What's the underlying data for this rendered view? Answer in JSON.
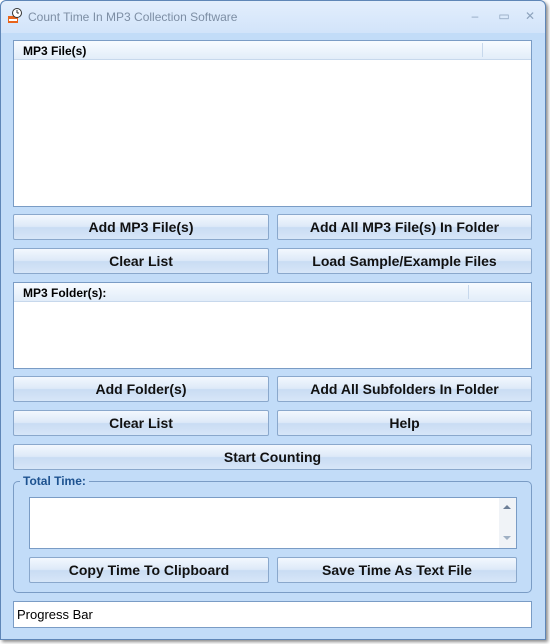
{
  "window": {
    "title": "Count Time In MP3 Collection Software",
    "controls": {
      "minimize": "–",
      "maximize": "▭",
      "close": "✕"
    }
  },
  "files_list": {
    "header": "MP3 File(s)",
    "items": []
  },
  "files_buttons": {
    "add_files": "Add MP3 File(s)",
    "add_all_in_folder": "Add All MP3 File(s) In Folder",
    "clear_list": "Clear List",
    "load_samples": "Load Sample/Example Files"
  },
  "folders_list": {
    "header": "MP3 Folder(s):",
    "items": []
  },
  "folders_buttons": {
    "add_folders": "Add Folder(s)",
    "add_all_subfolders": "Add All Subfolders In Folder",
    "clear_list": "Clear List",
    "help": "Help"
  },
  "start_button": "Start Counting",
  "total_time": {
    "label": "Total Time:",
    "value": "",
    "copy_button": "Copy Time To Clipboard",
    "save_button": "Save Time As Text File"
  },
  "status": {
    "progress_label": "Progress Bar"
  }
}
